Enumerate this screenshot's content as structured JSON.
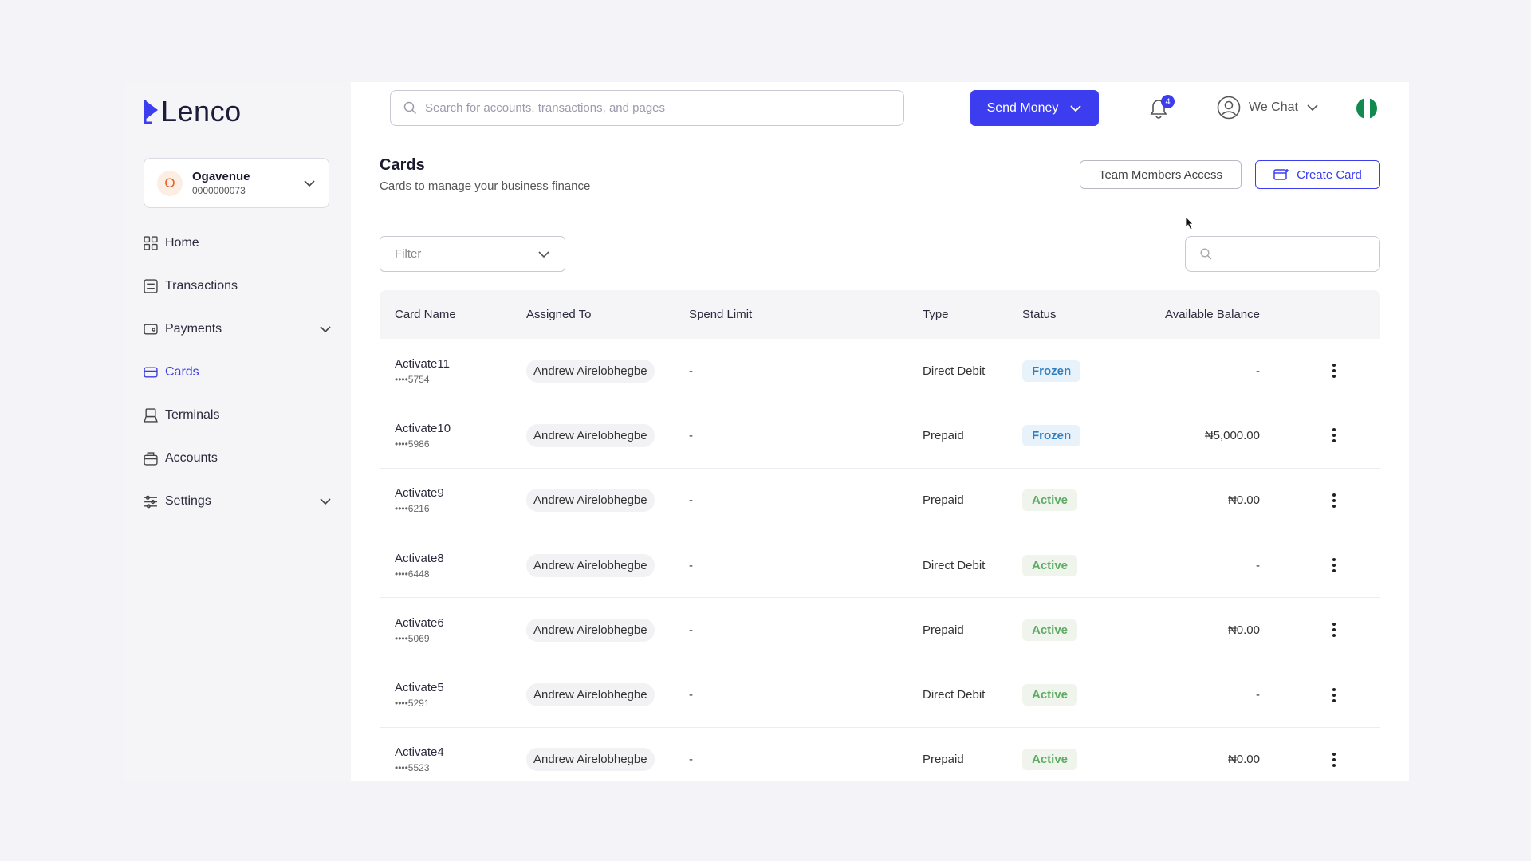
{
  "brand": {
    "name": "Lenco",
    "accent": "#3d3df0"
  },
  "account": {
    "initial": "O",
    "name": "Ogavenue",
    "number": "0000000073"
  },
  "nav": [
    {
      "label": "Home",
      "icon": "home-icon",
      "expandable": false,
      "active": false
    },
    {
      "label": "Transactions",
      "icon": "transactions-icon",
      "expandable": false,
      "active": false
    },
    {
      "label": "Payments",
      "icon": "payments-icon",
      "expandable": true,
      "active": false
    },
    {
      "label": "Cards",
      "icon": "card-icon",
      "expandable": false,
      "active": true
    },
    {
      "label": "Terminals",
      "icon": "terminal-icon",
      "expandable": false,
      "active": false
    },
    {
      "label": "Accounts",
      "icon": "accounts-icon",
      "expandable": false,
      "active": false
    },
    {
      "label": "Settings",
      "icon": "settings-icon",
      "expandable": true,
      "active": false
    }
  ],
  "topbar": {
    "search_placeholder": "Search for accounts, transactions, and pages",
    "send_money_label": "Send Money",
    "notification_count": "4",
    "user_name": "We Chat"
  },
  "page": {
    "title": "Cards",
    "subtitle": "Cards to manage your business finance",
    "team_access_label": "Team Members Access",
    "create_card_label": "Create Card",
    "filter_label": "Filter"
  },
  "table": {
    "columns": [
      "Card Name",
      "Assigned To",
      "Spend Limit",
      "Type",
      "Status",
      "Available Balance"
    ],
    "rows": [
      {
        "name": "Activate11",
        "last4": "••••5754",
        "assigned": "Andrew Airelobhegbe",
        "limit": "-",
        "type": "Direct Debit",
        "status": "Frozen",
        "balance": "-"
      },
      {
        "name": "Activate10",
        "last4": "••••5986",
        "assigned": "Andrew Airelobhegbe",
        "limit": "-",
        "type": "Prepaid",
        "status": "Frozen",
        "balance": "₦5,000.00"
      },
      {
        "name": "Activate9",
        "last4": "••••6216",
        "assigned": "Andrew Airelobhegbe",
        "limit": "-",
        "type": "Prepaid",
        "status": "Active",
        "balance": "₦0.00"
      },
      {
        "name": "Activate8",
        "last4": "••••6448",
        "assigned": "Andrew Airelobhegbe",
        "limit": "-",
        "type": "Direct Debit",
        "status": "Active",
        "balance": "-"
      },
      {
        "name": "Activate6",
        "last4": "••••5069",
        "assigned": "Andrew Airelobhegbe",
        "limit": "-",
        "type": "Prepaid",
        "status": "Active",
        "balance": "₦0.00"
      },
      {
        "name": "Activate5",
        "last4": "••••5291",
        "assigned": "Andrew Airelobhegbe",
        "limit": "-",
        "type": "Direct Debit",
        "status": "Active",
        "balance": "-"
      },
      {
        "name": "Activate4",
        "last4": "••••5523",
        "assigned": "Andrew Airelobhegbe",
        "limit": "-",
        "type": "Prepaid",
        "status": "Active",
        "balance": "₦0.00"
      }
    ]
  },
  "colors": {
    "frozen": "#2f7fc1",
    "active": "#5faa64",
    "flag_green": "#118a4d"
  }
}
